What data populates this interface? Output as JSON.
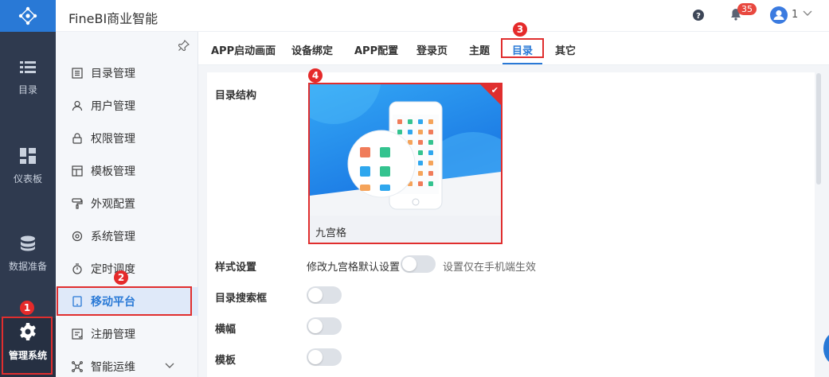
{
  "header": {
    "app_title": "FineBI商业智能",
    "notification_count": "35",
    "user_name": "1"
  },
  "rail": {
    "items": [
      {
        "label": "目录",
        "icon": "list-icon"
      },
      {
        "label": "仪表板",
        "icon": "dashboard-icon"
      },
      {
        "label": "数据准备",
        "icon": "database-icon"
      },
      {
        "label": "管理系统",
        "icon": "gear-icon",
        "active": true
      }
    ]
  },
  "menu": {
    "items": [
      {
        "label": "目录管理",
        "icon": "catalog-icon"
      },
      {
        "label": "用户管理",
        "icon": "user-icon"
      },
      {
        "label": "权限管理",
        "icon": "lock-icon"
      },
      {
        "label": "模板管理",
        "icon": "template-icon"
      },
      {
        "label": "外观配置",
        "icon": "paint-roller-icon"
      },
      {
        "label": "系统管理",
        "icon": "settings-icon"
      },
      {
        "label": "定时调度",
        "icon": "timer-icon"
      },
      {
        "label": "移动平台",
        "icon": "tablet-icon",
        "active": true
      },
      {
        "label": "注册管理",
        "icon": "register-icon"
      },
      {
        "label": "智能运维",
        "icon": "network-icon"
      }
    ]
  },
  "tabs": [
    {
      "label": "APP启动画面"
    },
    {
      "label": "设备绑定"
    },
    {
      "label": "APP配置"
    },
    {
      "label": "登录页"
    },
    {
      "label": "主题"
    },
    {
      "label": "目录",
      "active": true
    },
    {
      "label": "其它"
    }
  ],
  "form": {
    "structure_label": "目录结构",
    "card_caption": "九宫格",
    "style_label": "样式设置",
    "style_toggle_label": "修改九宫格默认设置",
    "style_hint": "设置仅在手机端生效",
    "search_label": "目录搜索框",
    "banner_label": "横幅",
    "template_label": "模板",
    "toggles": {
      "style": false,
      "search": false,
      "banner": false,
      "template": false
    }
  },
  "markers": [
    "1",
    "2",
    "3",
    "4"
  ],
  "colors": {
    "accent": "#2979d6",
    "rail": "#2f3a4f",
    "annotation": "#e02e2e"
  }
}
